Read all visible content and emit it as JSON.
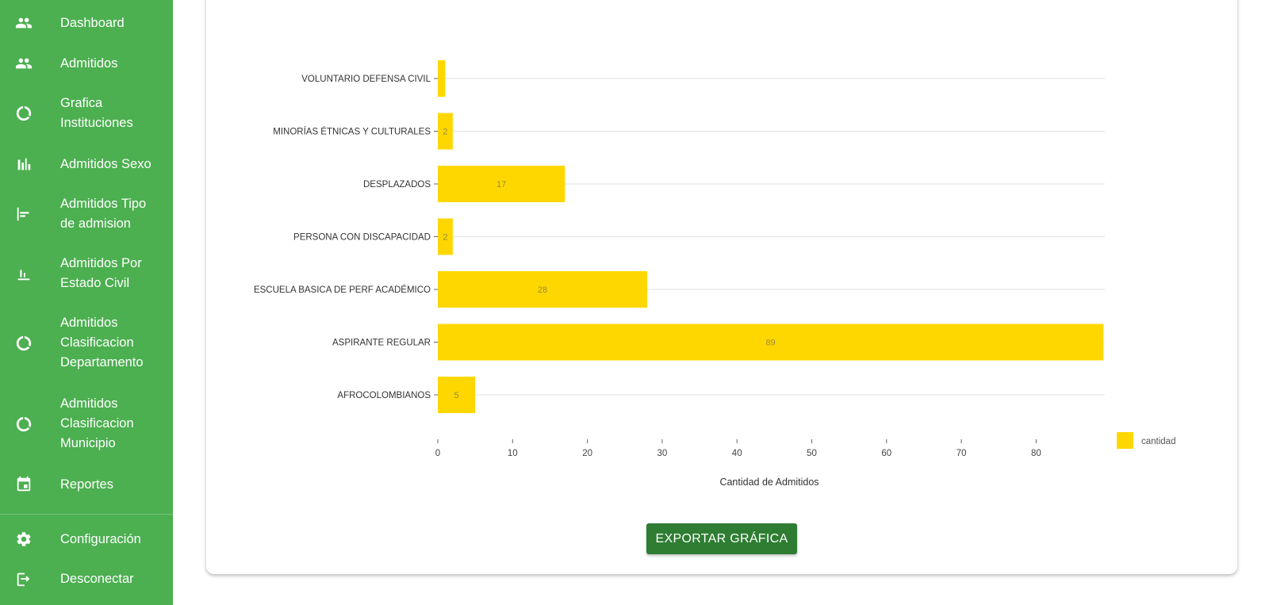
{
  "sidebar": {
    "items": [
      {
        "label": "Dashboard",
        "icon": "people-icon"
      },
      {
        "label": "Admitidos",
        "icon": "people-icon"
      },
      {
        "label": "Grafica\nInstituciones",
        "icon": "donut-icon"
      },
      {
        "label": "Admitidos Sexo",
        "icon": "bar-chart-icon"
      },
      {
        "label": "Admitidos Tipo\nde admision",
        "icon": "align-left-icon"
      },
      {
        "label": "Admitidos Por\nEstado Civil",
        "icon": "bar-chart-underline-icon"
      },
      {
        "label": "Admitidos\nClasificacion\nDepartamento",
        "icon": "donut-icon"
      },
      {
        "label": "Admitidos\nClasificacion\nMunicipio",
        "icon": "donut-icon"
      },
      {
        "label": "Reportes",
        "icon": "calendar-icon"
      },
      {
        "label": "Configuración",
        "icon": "gear-icon"
      },
      {
        "label": "Desconectar",
        "icon": "logout-icon"
      }
    ]
  },
  "export_button": {
    "label": "EXPORTAR GRÁFICA"
  },
  "colors": {
    "sidebar": "#4caf50",
    "bar": "#ffd700",
    "button": "#2e7d32"
  },
  "chart_data": {
    "type": "bar",
    "orientation": "horizontal",
    "categories": [
      "VOLUNTARIO DEFENSA CIVIL",
      "MINORÍAS ÉTNICAS Y CULTURALES",
      "DESPLAZADOS",
      "PERSONA CON DISCAPACIDAD",
      "ESCUELA BASICA DE PERF ACADÉMICO",
      "ASPIRANTE REGULAR",
      "AFROCOLOMBIANOS"
    ],
    "series": [
      {
        "name": "cantidad",
        "values": [
          1,
          2,
          17,
          2,
          28,
          89,
          5
        ]
      }
    ],
    "data_labels_shown": [
      false,
      true,
      true,
      true,
      true,
      true,
      true
    ],
    "xlabel": "Cantidad de Admitidos",
    "ylabel": "",
    "xticks": [
      0,
      10,
      20,
      30,
      40,
      50,
      60,
      70,
      80
    ],
    "xlim": [
      0,
      89
    ],
    "grid": true,
    "legend": "right"
  }
}
